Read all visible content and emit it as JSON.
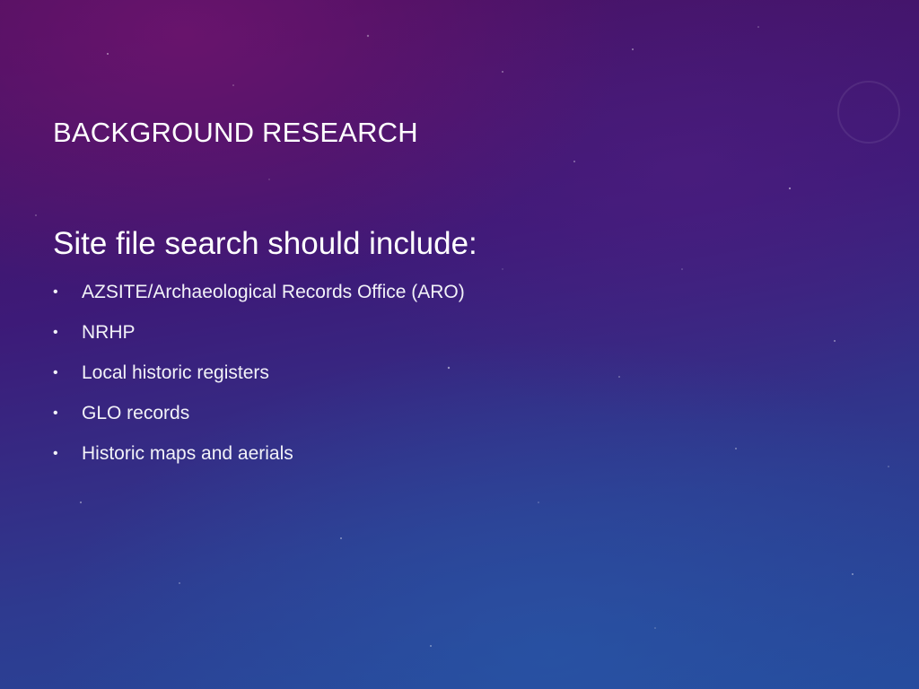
{
  "slide": {
    "title": "BACKGROUND RESEARCH",
    "heading": "Site file search should include:",
    "bullet_glyph": "•",
    "bullets": [
      "AZSITE/Archaeological Records Office (ARO)",
      "NRHP",
      "Local historic registers",
      "GLO records",
      "Historic maps and aerials"
    ]
  },
  "colors": {
    "background_top": "#4a0f5e",
    "background_bottom": "#254a9c",
    "text": "#ffffff"
  }
}
